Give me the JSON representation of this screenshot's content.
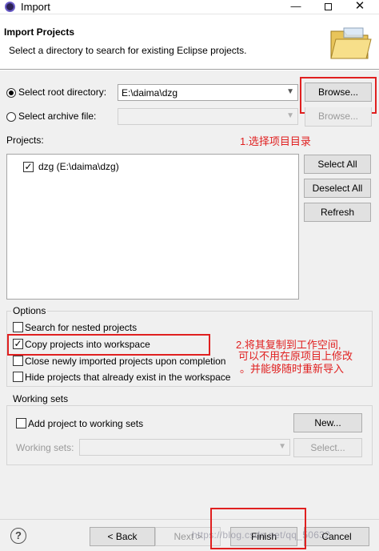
{
  "window": {
    "title": "Import",
    "minimize_glyph": "—",
    "close_glyph": "✕"
  },
  "header": {
    "title": "Import Projects",
    "description": "Select a directory to search for existing Eclipse projects."
  },
  "source": {
    "root_label": "Select root directory:",
    "root_value": "E:\\daima\\dzg",
    "archive_label": "Select archive file:",
    "archive_value": "",
    "browse_root": "Browse...",
    "browse_archive": "Browse..."
  },
  "projects": {
    "label": "Projects:",
    "items": [
      {
        "label": "dzg (E:\\daima\\dzg)",
        "checked": true
      }
    ],
    "select_all": "Select All",
    "deselect_all": "Deselect All",
    "refresh": "Refresh"
  },
  "options": {
    "title": "Options",
    "search_nested": "Search for nested projects",
    "copy_into_workspace": "Copy projects into workspace",
    "close_after_completion": "Close newly imported projects upon completion",
    "hide_existing": "Hide projects that already exist in the workspace"
  },
  "working_sets": {
    "title": "Working sets",
    "add_label": "Add project to working sets",
    "new_button": "New...",
    "sets_label": "Working sets:",
    "sets_value": "",
    "select_button": "Select..."
  },
  "annotations": {
    "note1": "1.选择项目目录",
    "note2_line1": "2.将其复制到工作空间,",
    "note2_line2": "可以不用在原项目上修改",
    "note2_line3": "。并能够随时重新导入",
    "color": "#e02020"
  },
  "footer": {
    "help": "?",
    "back": "< Back",
    "next": "Next >",
    "finish": "Finish",
    "cancel": "Cancel",
    "watermark": "https://blog.csdn.net/qq_50632"
  }
}
